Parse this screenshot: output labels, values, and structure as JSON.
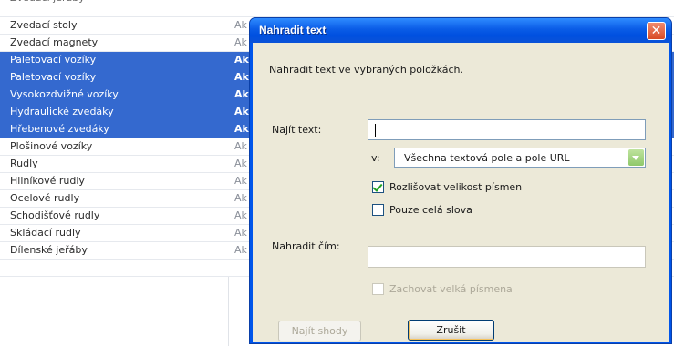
{
  "list": {
    "rows": [
      {
        "name": "Zvedací stoly",
        "col2": "Ak",
        "selected": false
      },
      {
        "name": "Zvedací magnety",
        "col2": "Ak",
        "selected": false
      },
      {
        "name": "Paletovací vozíky",
        "col2": "Ak",
        "selected": true
      },
      {
        "name": "Paletovací vozíky",
        "col2": "Ak",
        "selected": true
      },
      {
        "name": "Vysokozdvižné vozíky",
        "col2": "Ak",
        "selected": true
      },
      {
        "name": "Hydraulické zvedáky",
        "col2": "Ak",
        "selected": true
      },
      {
        "name": "Hřebenové zvedáky",
        "col2": "Ak",
        "selected": true
      },
      {
        "name": "Plošinové vozíky",
        "col2": "Ak",
        "selected": false
      },
      {
        "name": "Rudly",
        "col2": "Ak",
        "selected": false
      },
      {
        "name": "Hliníkové rudly",
        "col2": "Ak",
        "selected": false
      },
      {
        "name": "Ocelové rudly",
        "col2": "Ak",
        "selected": false
      },
      {
        "name": "Schodišťové rudly",
        "col2": "Ak",
        "selected": false
      },
      {
        "name": "Skládací rudly",
        "col2": "Ak",
        "selected": false
      },
      {
        "name": "Dílenské jeřáby",
        "col2": "Ak",
        "selected": false
      }
    ]
  },
  "dialog": {
    "title": "Nahradit text",
    "close_glyph": "✕",
    "description": "Nahradit text ve vybraných položkách.",
    "find_label": "Najít text:",
    "find_value": "",
    "in_label": "v:",
    "scope_value": "Všechna textová pole a pole URL",
    "match_case_label": "Rozlišovat velikost písmen",
    "match_case_checked": true,
    "whole_words_label": "Pouze celá slova",
    "whole_words_checked": false,
    "replace_label": "Nahradit čím:",
    "replace_value": "",
    "preserve_case_label": "Zachovat velká písmena",
    "preserve_case_checked": false,
    "find_matches_button": "Najít shody",
    "cancel_button": "Zrušit"
  },
  "colors": {
    "selection": "#3469cf",
    "titlebar": "#0055ea",
    "dialog_bg": "#ece9d8",
    "close_red": "#d84a25"
  }
}
